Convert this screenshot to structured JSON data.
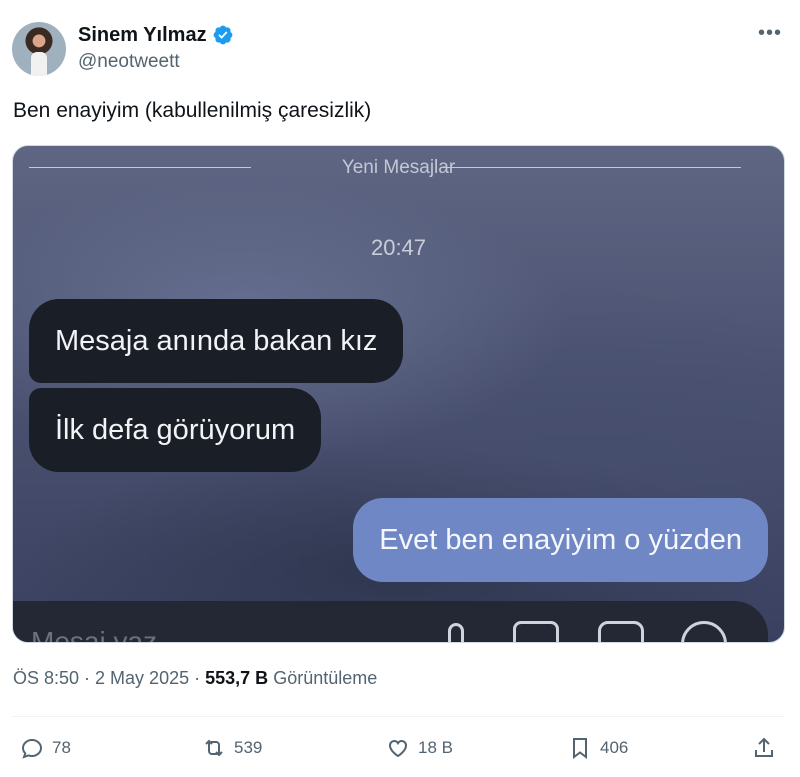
{
  "author": {
    "name": "Sinem Yılmaz",
    "handle": "@neotweett"
  },
  "tweet": {
    "text": "Ben enayiyim (kabullenilmiş çaresizlik)"
  },
  "image": {
    "new_messages_label": "Yeni Mesajlar",
    "time": "20:47",
    "messages": [
      {
        "text": "Mesaja anında bakan kız",
        "side": "left"
      },
      {
        "text": "İlk defa görüyorum",
        "side": "left"
      },
      {
        "text": "Evet ben enayiyim o yüzden",
        "side": "right"
      }
    ],
    "composer_placeholder": "Mesaj yaz..."
  },
  "meta": {
    "time_date": "ÖS 8:50 · 2 May 2025",
    "dot": "·",
    "views_count": "553,7 B",
    "views_label": "Görüntüleme"
  },
  "actions": {
    "replies": "78",
    "reposts": "539",
    "likes": "18 B",
    "bookmarks": "406"
  },
  "colors": {
    "verified": "#1d9bf0",
    "outgoing_bubble": "#6f88c5",
    "incoming_bubble": "#1a1e26"
  }
}
